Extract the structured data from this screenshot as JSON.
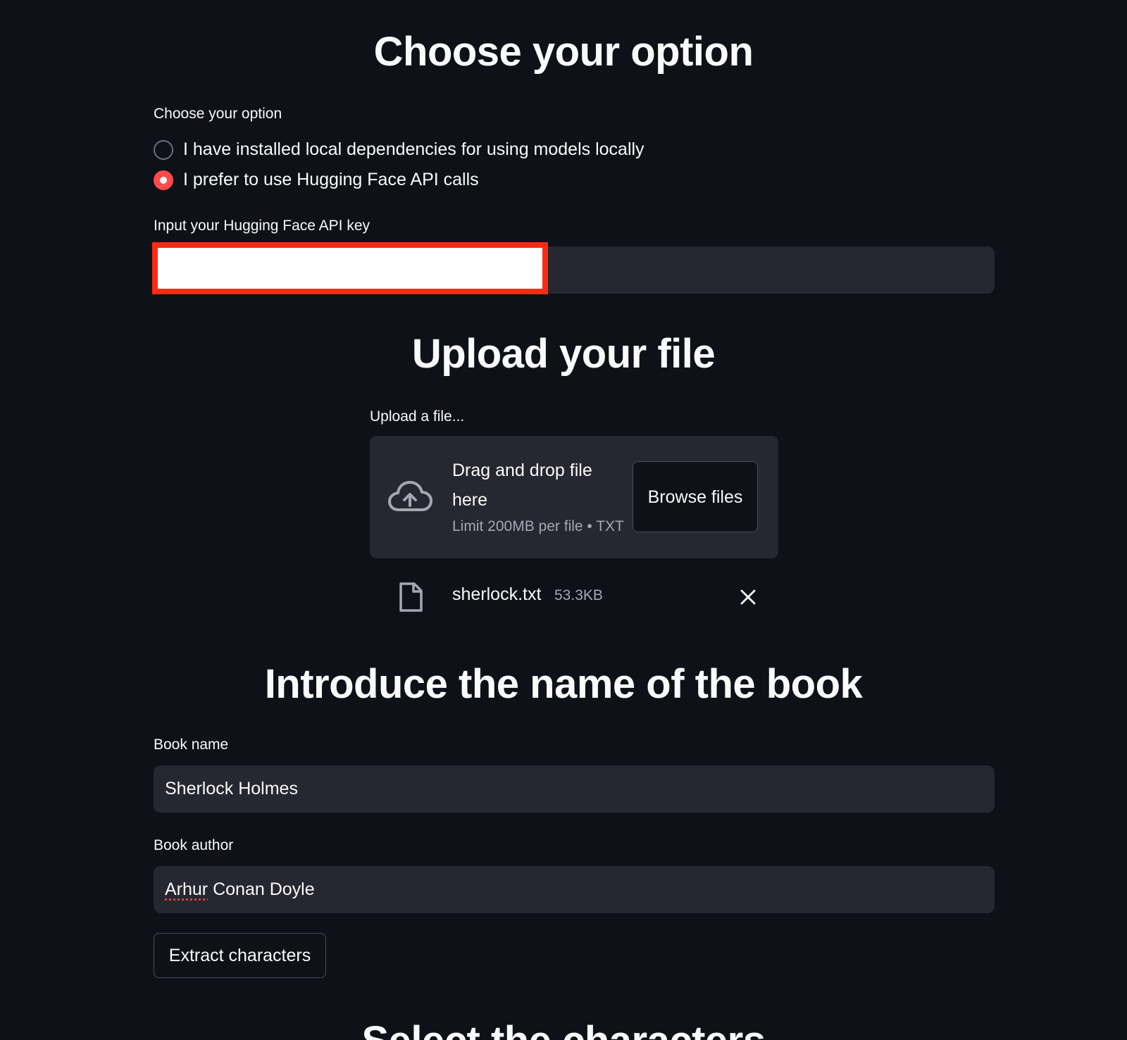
{
  "option_section": {
    "heading": "Choose your option",
    "radio_label": "Choose your option",
    "options": [
      {
        "label": "I have installed local dependencies for using models locally",
        "selected": false
      },
      {
        "label": "I prefer to use Hugging Face API calls",
        "selected": true
      }
    ],
    "api_key_label": "Input your Hugging Face API key",
    "api_key_value": ""
  },
  "upload_section": {
    "heading": "Upload your file",
    "uploader_label": "Upload a file...",
    "dropzone_text": "Drag and drop file here",
    "limit_text": "Limit 200MB per file • TXT",
    "browse_label": "Browse files",
    "file": {
      "name": "sherlock.txt",
      "size": "53.3KB"
    }
  },
  "book_section": {
    "heading": "Introduce the name of the book",
    "name_label": "Book name",
    "name_value": "Sherlock Holmes",
    "author_label": "Book author",
    "author_value_misspelled": "Arhur",
    "author_value_rest": " Conan Doyle",
    "extract_label": "Extract characters"
  },
  "next_section": {
    "heading": "Select the characters"
  },
  "colors": {
    "background": "#0e1117",
    "input_bg": "#262730",
    "accent": "#ff4b4b",
    "redaction_border": "#ff2a12"
  },
  "icons": [
    "cloud-upload-icon",
    "file-icon",
    "close-icon"
  ]
}
